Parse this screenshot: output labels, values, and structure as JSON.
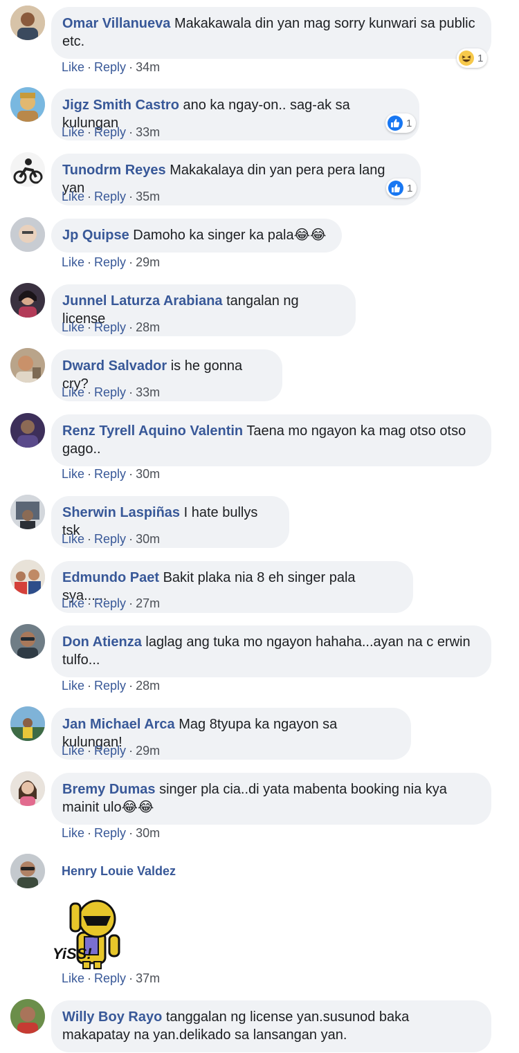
{
  "actions": {
    "like": "Like",
    "reply": "Reply"
  },
  "comments": [
    {
      "author": "Omar Villanueva",
      "text": "Makakawala din yan mag sorry kunwari sa public etc.",
      "time": "34m",
      "reaction": {
        "icon": "haha-icon",
        "count": "1"
      }
    },
    {
      "author": "Jigz Smith Castro",
      "text": "ano ka ngay-on.. sag-ak sa kulungan",
      "time": "33m",
      "reaction": {
        "icon": "like-icon",
        "count": "1"
      }
    },
    {
      "author": "Tunodrm Reyes",
      "text": "Makakalaya din yan pera pera lang yan",
      "time": "35m",
      "reaction": {
        "icon": "like-icon",
        "count": "1"
      }
    },
    {
      "author": "Jp Quipse",
      "text": "Damoho ka singer ka pala😂😂",
      "time": "29m"
    },
    {
      "author": "Junnel Laturza Arabiana",
      "text": "tangalan ng license",
      "time": "28m"
    },
    {
      "author": "Dward Salvador",
      "text": "is he gonna cry?",
      "time": "33m"
    },
    {
      "author": "Renz Tyrell Aquino Valentin",
      "text": "Taena mo ngayon ka mag otso otso gago..",
      "time": "30m"
    },
    {
      "author": "Sherwin Laspiñas",
      "text": "I hate bullys tsk",
      "time": "30m"
    },
    {
      "author": "Edmundo Paet",
      "text": "Bakit plaka nia 8 eh singer pala sya......",
      "time": "27m"
    },
    {
      "author": "Don Atienza",
      "text": "laglag ang tuka mo ngayon hahaha...ayan na c erwin tulfo...",
      "time": "28m"
    },
    {
      "author": "Jan Michael Arca",
      "text": "Mag 8tyupa ka ngayon sa kulungan!",
      "time": "29m"
    },
    {
      "author": "Bremy Dumas",
      "text": "singer pla cia..di yata mabenta booking nia kya mainit ulo😂😂",
      "time": "30m"
    },
    {
      "author": "Henry Louie Valdez",
      "text": "",
      "time": "37m",
      "sticker": {
        "caption": "YiSS!"
      }
    },
    {
      "author": "Willy Boy Rayo",
      "text": "tanggalan ng license yan.susunod baka makapatay na yan.delikado sa lansangan yan.",
      "time": ""
    }
  ],
  "colors": {
    "author": "#385898",
    "bubble": "#f0f2f5",
    "meta": "#4b4f56",
    "like_blue": "#1877f2"
  }
}
